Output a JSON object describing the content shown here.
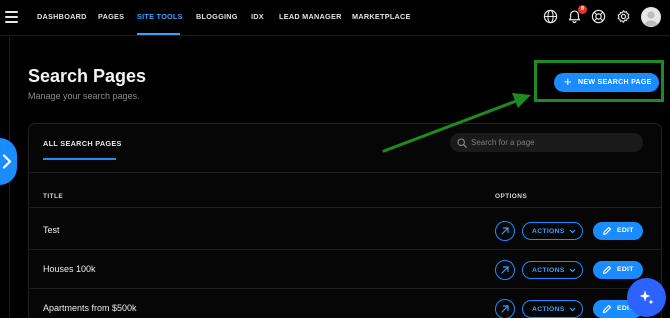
{
  "nav": {
    "items": [
      "DASHBOARD",
      "PAGES",
      "SITE TOOLS",
      "BLOGGING",
      "IDX",
      "LEAD MANAGER",
      "MARKETPLACE"
    ],
    "active": "SITE TOOLS",
    "notification_count": "8"
  },
  "header": {
    "title": "Search Pages",
    "subtitle": "Manage your search pages.",
    "new_button": "NEW SEARCH PAGE"
  },
  "panel": {
    "tab": "ALL SEARCH PAGES",
    "search_placeholder": "Search for a page",
    "columns": {
      "title": "TITLE",
      "options": "OPTIONS"
    },
    "rows": [
      {
        "title": "Test"
      },
      {
        "title": "Houses 100k"
      },
      {
        "title": "Apartments from $500k"
      }
    ],
    "actions_label": "ACTIONS",
    "edit_label": "EDIT"
  },
  "colors": {
    "accent": "#1a8cff",
    "annotation_green": "#1f8a1f",
    "badge_red": "#e5362b"
  },
  "icons": [
    "menu-icon",
    "globe-icon",
    "bell-icon",
    "help-icon",
    "gear-icon",
    "avatar-icon",
    "chevron-right-icon",
    "plus-icon",
    "search-icon",
    "open-external-icon",
    "chevron-down-icon",
    "pencil-icon",
    "sparkle-icon"
  ]
}
